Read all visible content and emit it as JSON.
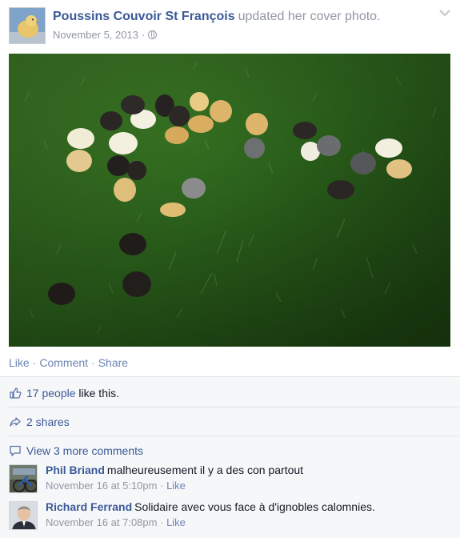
{
  "post": {
    "author_name": "Poussins Couvoir St François",
    "action_text": "updated her cover photo.",
    "date": "November 5, 2013",
    "meta_separator": "·",
    "privacy_icon": "globe-icon",
    "menu_icon": "chevron-down-icon",
    "photo_subject": "chicks-on-grass"
  },
  "actions": {
    "like": "Like",
    "comment": "Comment",
    "share": "Share",
    "separator": "·"
  },
  "ufi": {
    "likes_count": "17 people",
    "likes_suffix": "like this.",
    "shares": "2 shares",
    "view_more": "View 3 more comments",
    "comments": [
      {
        "name": "Phil Briand",
        "text": "malheureusement il y a des con partout",
        "time": "November 16 at 5:10pm",
        "separator": "·",
        "like": "Like"
      },
      {
        "name": "Richard Ferrand",
        "text": "Solidaire avec vous face à d'ignobles calomnies.",
        "time": "November 16 at 7:08pm",
        "separator": "·",
        "like": "Like"
      }
    ]
  },
  "colors": {
    "link_blue": "#3b5998",
    "muted_gray": "#9197a3",
    "action_link": "#6d84b4",
    "ufi_background": "#f6f7f9"
  }
}
